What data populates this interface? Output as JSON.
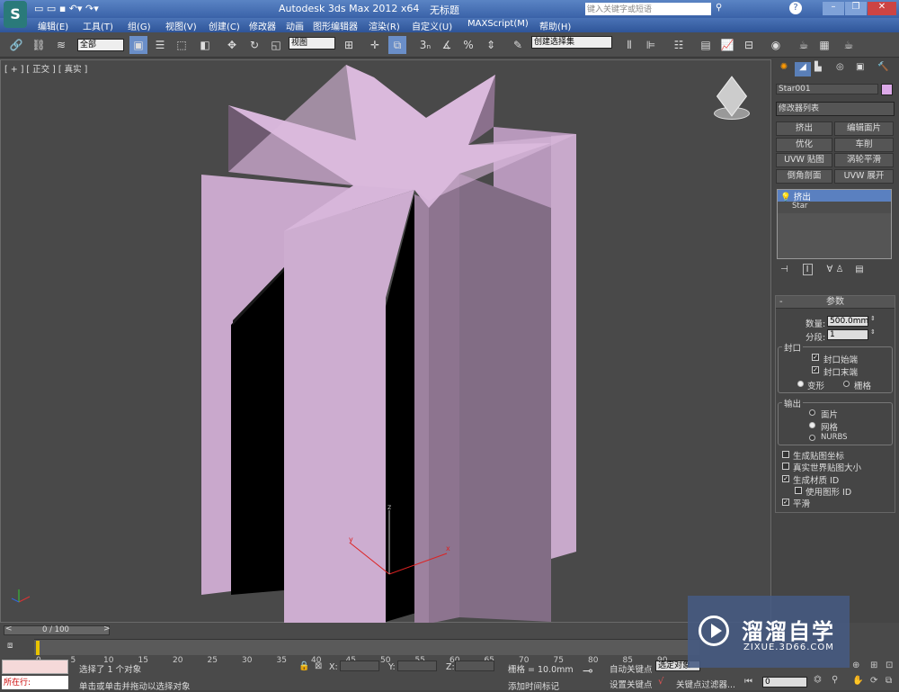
{
  "title": {
    "app": "Autodesk 3ds Max  2012 x64",
    "doc": "无标题",
    "search_placeholder": "键入关键字或短语"
  },
  "menu": [
    "编辑(E)",
    "工具(T)",
    "组(G)",
    "视图(V)",
    "创建(C)",
    "修改器",
    "动画",
    "图形编辑器",
    "渲染(R)",
    "自定义(U)",
    "MAXScript(M)",
    "帮助(H)"
  ],
  "toolbar": {
    "filter": "全部",
    "refcoord": "视图",
    "selset": "创建选择集"
  },
  "viewport": {
    "label": "[ + ] [ 正交 ] [ 真实 ]",
    "axis_x": "x",
    "axis_y": "y",
    "axis_z": "z"
  },
  "panel": {
    "object_name": "Star001",
    "object_color": "#dca9e8",
    "modlist": "修改器列表",
    "buttons": [
      "挤出",
      "编辑面片",
      "优化",
      "车削",
      "UVW 贴图",
      "涡轮平滑",
      "倒角剖面",
      "UVW 展开"
    ],
    "stack": [
      "挤出",
      "Star"
    ],
    "rollout": "参数",
    "amount_label": "数量:",
    "amount": "500.0mm",
    "segments_label": "分段:",
    "segments": "1",
    "capping": "封口",
    "cap_start": "封口始端",
    "cap_end": "封口末端",
    "morph": "变形",
    "grid": "栅格",
    "output": "输出",
    "patch": "面片",
    "mesh": "网格",
    "nurbs": "NURBS",
    "gen_map": "生成贴图坐标",
    "real_world": "真实世界贴图大小",
    "gen_mat": "生成材质 ID",
    "use_shape": "使用图形 ID",
    "smooth": "平滑"
  },
  "timeline": {
    "frame": "0 / 100",
    "ticks": [
      "0",
      "5",
      "10",
      "15",
      "20",
      "25",
      "30",
      "35",
      "40",
      "45",
      "50",
      "55",
      "60",
      "65",
      "70",
      "75",
      "80",
      "85",
      "90"
    ]
  },
  "status": {
    "running": "所在行:",
    "selected": "选择了 1 个对象",
    "hint": "单击或单击并拖动以选择对象",
    "x": "X:",
    "y": "Y:",
    "z": "Z:",
    "grid": "栅格 = 10.0mm",
    "autokey": "自动关键点",
    "selobj": "选定对象",
    "setkey": "设置关键点",
    "keyfilter": "关键点过滤器...",
    "addtime": "添加时间标记",
    "frame_input": "0"
  },
  "watermark": {
    "brand": "溜溜自学",
    "url": "ZIXUE.3D66.COM"
  }
}
